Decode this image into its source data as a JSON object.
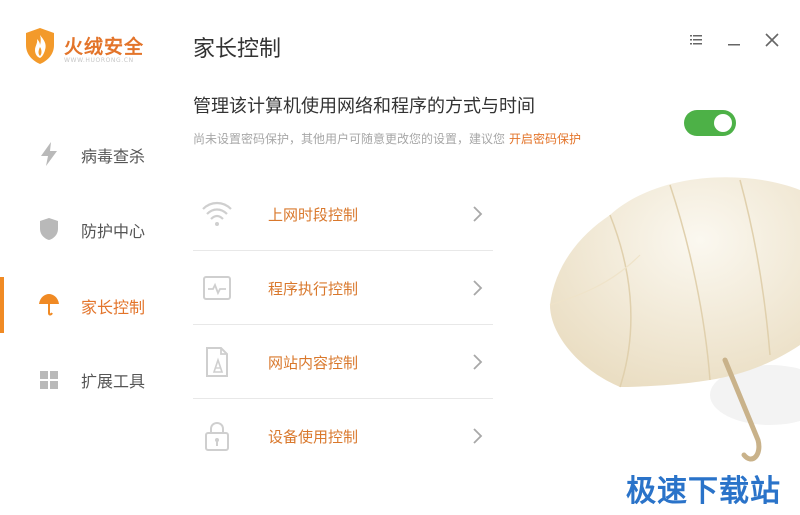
{
  "app": {
    "name": "火绒安全",
    "url": "WWW.HUORONG.CN"
  },
  "sidebar": {
    "items": [
      {
        "label": "病毒查杀",
        "icon": "lightning-icon",
        "active": false
      },
      {
        "label": "防护中心",
        "icon": "shield-icon",
        "active": false
      },
      {
        "label": "家长控制",
        "icon": "umbrella-icon",
        "active": true
      },
      {
        "label": "扩展工具",
        "icon": "grid-icon",
        "active": false
      }
    ]
  },
  "header": {
    "title": "家长控制",
    "menu_icon": "menu-icon",
    "minimize_icon": "minimize-icon",
    "close_icon": "close-icon"
  },
  "main": {
    "headline": "管理该计算机使用网络和程序的方式与时间",
    "subline": "尚未设置密码保护，其他用户可随意更改您的设置，建议您",
    "subline_link": "开启密码保护",
    "toggle_on": true,
    "controls": [
      {
        "label": "上网时段控制",
        "icon": "wifi-icon"
      },
      {
        "label": "程序执行控制",
        "icon": "program-monitor-icon"
      },
      {
        "label": "网站内容控制",
        "icon": "web-document-icon"
      },
      {
        "label": "设备使用控制",
        "icon": "lock-icon"
      }
    ]
  },
  "watermark": "极速下载站",
  "colors": {
    "accent": "#e3742a",
    "active_bar": "#f08a24",
    "toggle_on": "#4db147",
    "watermark": "#2a73c9"
  }
}
